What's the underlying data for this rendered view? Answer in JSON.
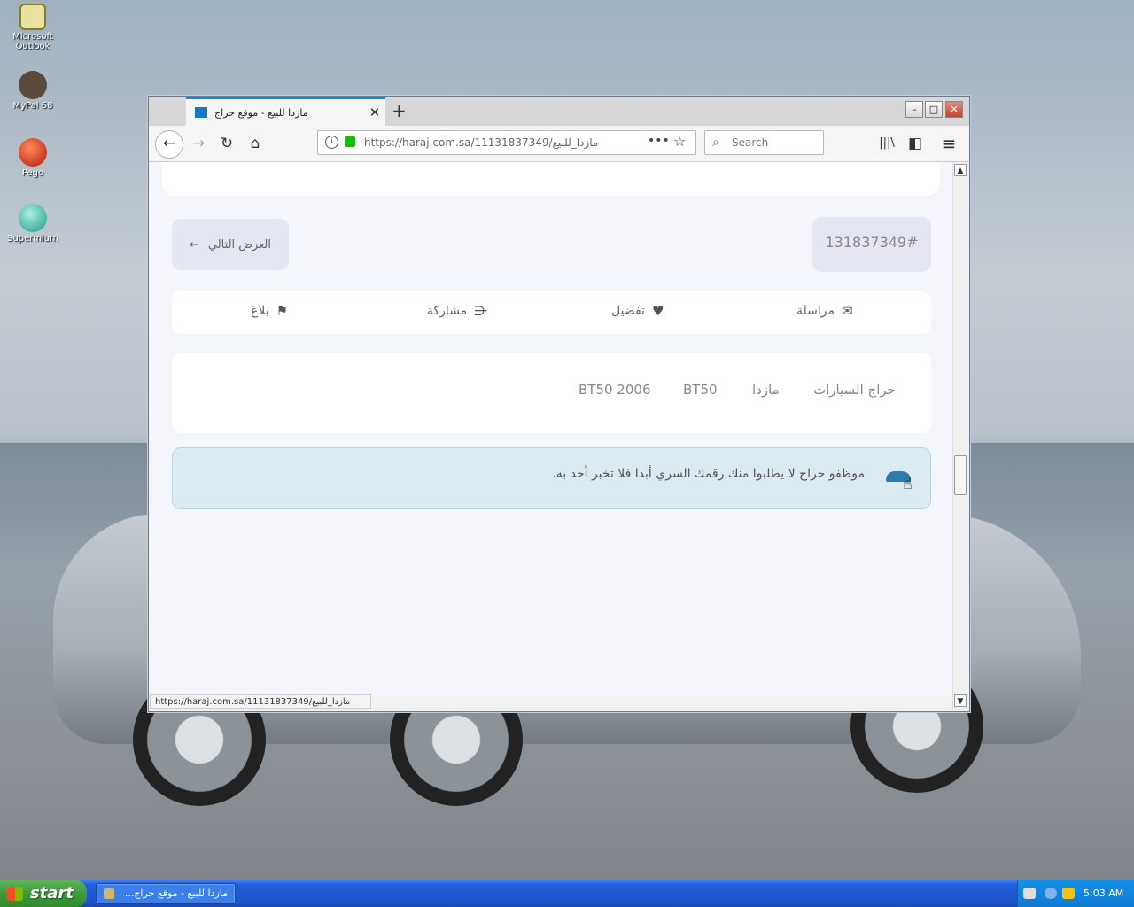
{
  "desktop": {
    "icons": [
      {
        "label": "Microsoft Outlook"
      },
      {
        "label": "MyPal 68"
      },
      {
        "label": "Pego"
      },
      {
        "label": "Supermium"
      }
    ]
  },
  "browser": {
    "tab": {
      "title": "مازدا للبيع - موقع حراج",
      "close": "✕"
    },
    "new_tab": "+",
    "window_buttons": {
      "minimize": "–",
      "maximize": "□",
      "close": "✕"
    },
    "nav": {
      "back": "←",
      "forward": "→",
      "reload": "↻",
      "home": "⌂"
    },
    "url": "https://haraj.com.sa/11131837349/مازدا_للبيع",
    "url_more": "•••",
    "bookmark_star": "☆",
    "search_placeholder": "Search",
    "toolbar_icons": {
      "library": "|||\\",
      "sidebar": "◧",
      "menu": "≡"
    },
    "status_url": "https://haraj.com.sa/11131837349/مازدا_للبيع"
  },
  "page": {
    "next_offer": "العرض التالي",
    "next_arrow": "←",
    "post_id": "131837349#",
    "actions": [
      {
        "label": "مراسلة",
        "icon": "envelope-icon",
        "glyph": "✉"
      },
      {
        "label": "تفضيل",
        "icon": "heart-icon",
        "glyph": "♥"
      },
      {
        "label": "مشاركة",
        "icon": "share-icon",
        "glyph": "⋲"
      },
      {
        "label": "بلاغ",
        "icon": "flag-icon",
        "glyph": "⚑"
      }
    ],
    "tags": [
      "حراج السيارات",
      "مازدا",
      "BT50",
      "BT50 2006"
    ],
    "notice": "موظفو حراج لا يطلبوا منك رقمك السري أبدا فلا تخبر أحد به."
  },
  "taskbar": {
    "start": "start",
    "task_title": "مازدا للبيع - موقع حراج...",
    "clock": "5:03 AM"
  }
}
